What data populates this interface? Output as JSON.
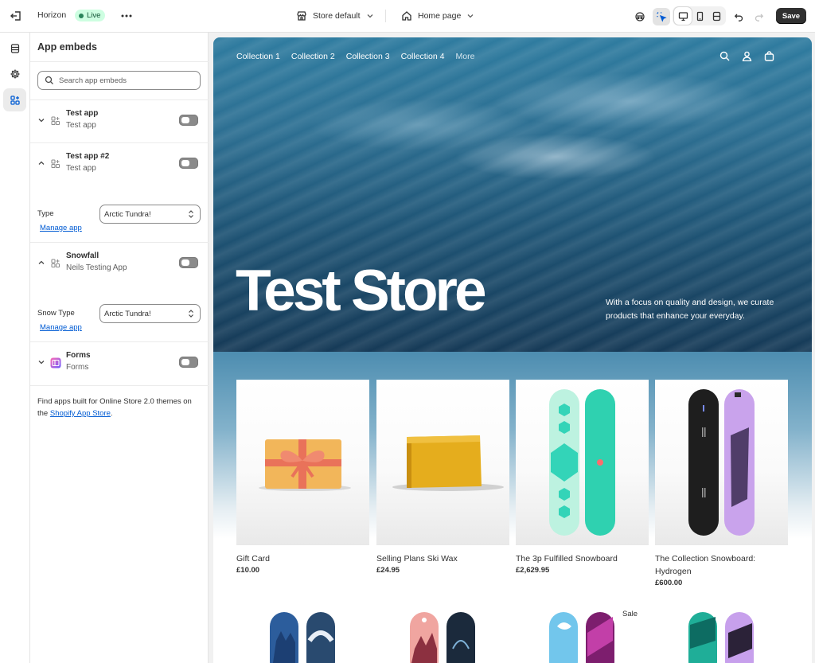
{
  "topbar": {
    "theme_name": "Horizon",
    "live_label": "Live",
    "store_selector": "Store default",
    "page_selector": "Home page",
    "save_label": "Save"
  },
  "panel": {
    "title": "App embeds",
    "search_placeholder": "Search app embeds",
    "apps": [
      {
        "name": "Test app",
        "subtitle": "Test app",
        "expanded": false,
        "enabled": false
      },
      {
        "name": "Test app #2",
        "subtitle": "Test app",
        "expanded": true,
        "enabled": false,
        "field_label": "Type",
        "field_value": "Arctic Tundra!",
        "link": "Manage app"
      },
      {
        "name": "Snowfall",
        "subtitle": "Neils Testing App",
        "expanded": true,
        "enabled": false,
        "field_label": "Snow Type",
        "field_value": "Arctic Tundra!",
        "link": "Manage app"
      },
      {
        "name": "Forms",
        "subtitle": "Forms",
        "expanded": false,
        "enabled": false
      }
    ],
    "footer_text": "Find apps built for Online Store 2.0 themes on the",
    "footer_link": "Shopify App Store",
    "footer_end": "."
  },
  "preview": {
    "nav": [
      "Collection 1",
      "Collection 2",
      "Collection 3",
      "Collection 4",
      "More"
    ],
    "hero_title": "Test Store",
    "hero_copy": "With a focus on quality and design, we curate products that enhance your everyday.",
    "products": [
      {
        "title": "Gift Card",
        "price": "£10.00"
      },
      {
        "title": "Selling Plans Ski Wax",
        "price": "£24.95"
      },
      {
        "title": "The 3p Fulfilled Snowboard",
        "price": "£2,629.95"
      },
      {
        "title": "The Collection Snowboard: Hydrogen",
        "price": "£600.00"
      }
    ],
    "sale_label": "Sale"
  },
  "colors": {
    "live_badge_bg": "#cdfee1",
    "save_button_bg": "#303030",
    "link": "#005bd3"
  }
}
